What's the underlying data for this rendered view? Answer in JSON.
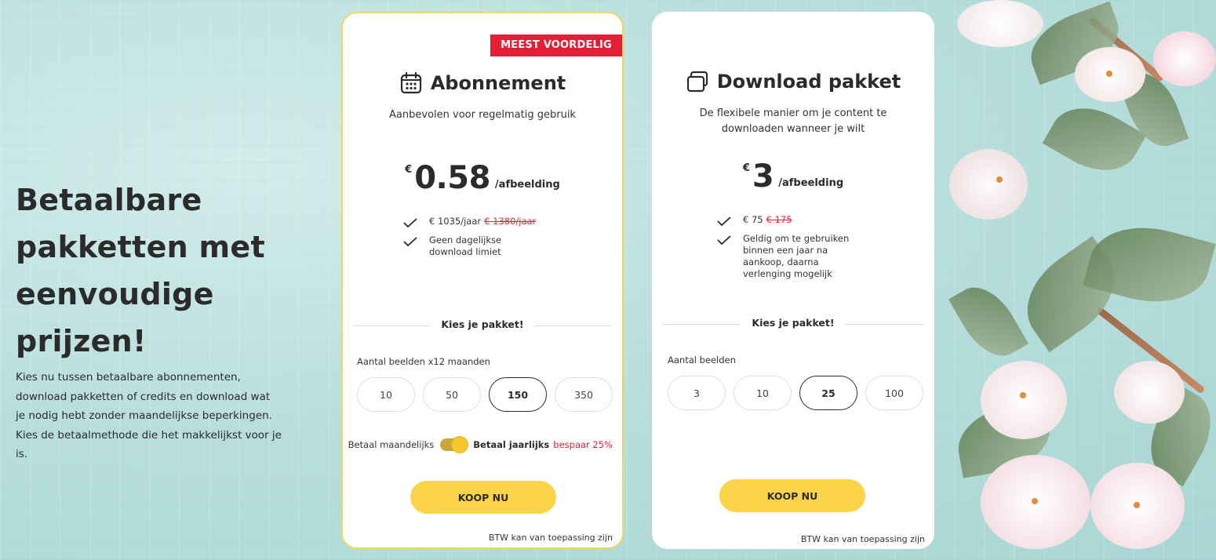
{
  "hero": {
    "title_line1": "Betaalbare",
    "title_line2": "pakketten met",
    "title_line3": "eenvoudige prijzen!",
    "description": "Kies nu tussen betaalbare abonnementen, download pakketten of credits en download wat je nodig hebt zonder maandelijkse beperkingen. Kies de betaalmethode die het makkelijkst voor je is."
  },
  "subscription": {
    "badge": "MEEST VOORDELIG",
    "icon": "calendar-icon",
    "title": "Abonnement",
    "subtitle": "Aanbevolen voor regelmatig gebruik",
    "currency": "€",
    "price": "0.58",
    "unit": "/afbeelding",
    "features": [
      {
        "text": "€ 1035/jaar",
        "old_price": "€ 1380/jaar"
      },
      {
        "text": "Geen dagelijkse download limiet"
      }
    ],
    "choose_label": "Kies je pakket!",
    "quantity_label": "Aantal beelden x12 maanden",
    "options": [
      "10",
      "50",
      "150",
      "350"
    ],
    "selected": "150",
    "toggle": {
      "monthly": "Betaal maandelijks",
      "yearly": "Betaal jaarlijks",
      "save": "bespaar 25%",
      "state": "yearly"
    },
    "buy_label": "KOOP NU",
    "tax_note": "BTW kan van toepassing zijn"
  },
  "download": {
    "icon": "image-stack-icon",
    "title": "Download pakket",
    "subtitle": "De flexibele manier om je content te downloaden wanneer je wilt",
    "currency": "€",
    "price": "3",
    "unit": "/afbeelding",
    "features": [
      {
        "text": "€ 75",
        "old_price": "€ 175"
      },
      {
        "text": "Geldig om te gebruiken binnen een jaar na aankoop, daarna verlenging mogelijk"
      }
    ],
    "choose_label": "Kies je pakket!",
    "quantity_label": "Aantal beelden",
    "options": [
      "3",
      "10",
      "25",
      "100"
    ],
    "selected": "25",
    "buy_label": "KOOP NU",
    "tax_note": "BTW kan van toepassing zijn"
  },
  "colors": {
    "accent_yellow": "#fcd44a",
    "badge_red": "#e41f35",
    "background_teal": "#b9dfdd",
    "text_dark": "#2b2b2b"
  }
}
